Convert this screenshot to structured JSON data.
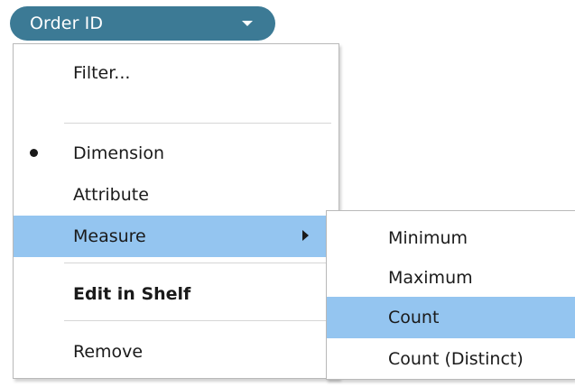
{
  "pill": {
    "label": "Order ID",
    "caret_icon": "caret-down-icon",
    "color": "#3c7a95"
  },
  "menu": {
    "filter_label": "Filter...",
    "dimension_label": "Dimension",
    "dimension_selected": true,
    "attribute_label": "Attribute",
    "measure_label": "Measure",
    "measure_highlighted": true,
    "edit_label": "Edit in Shelf",
    "remove_label": "Remove",
    "highlight_color": "#94c5f0",
    "submenu_arrow_icon": "chevron-right-icon",
    "bullet_icon": "radio-bullet-icon"
  },
  "submenu": {
    "items": [
      {
        "label": "Minimum",
        "highlighted": false
      },
      {
        "label": "Maximum",
        "highlighted": false
      },
      {
        "label": "Count",
        "highlighted": true
      },
      {
        "label": "Count (Distinct)",
        "highlighted": false
      }
    ]
  }
}
